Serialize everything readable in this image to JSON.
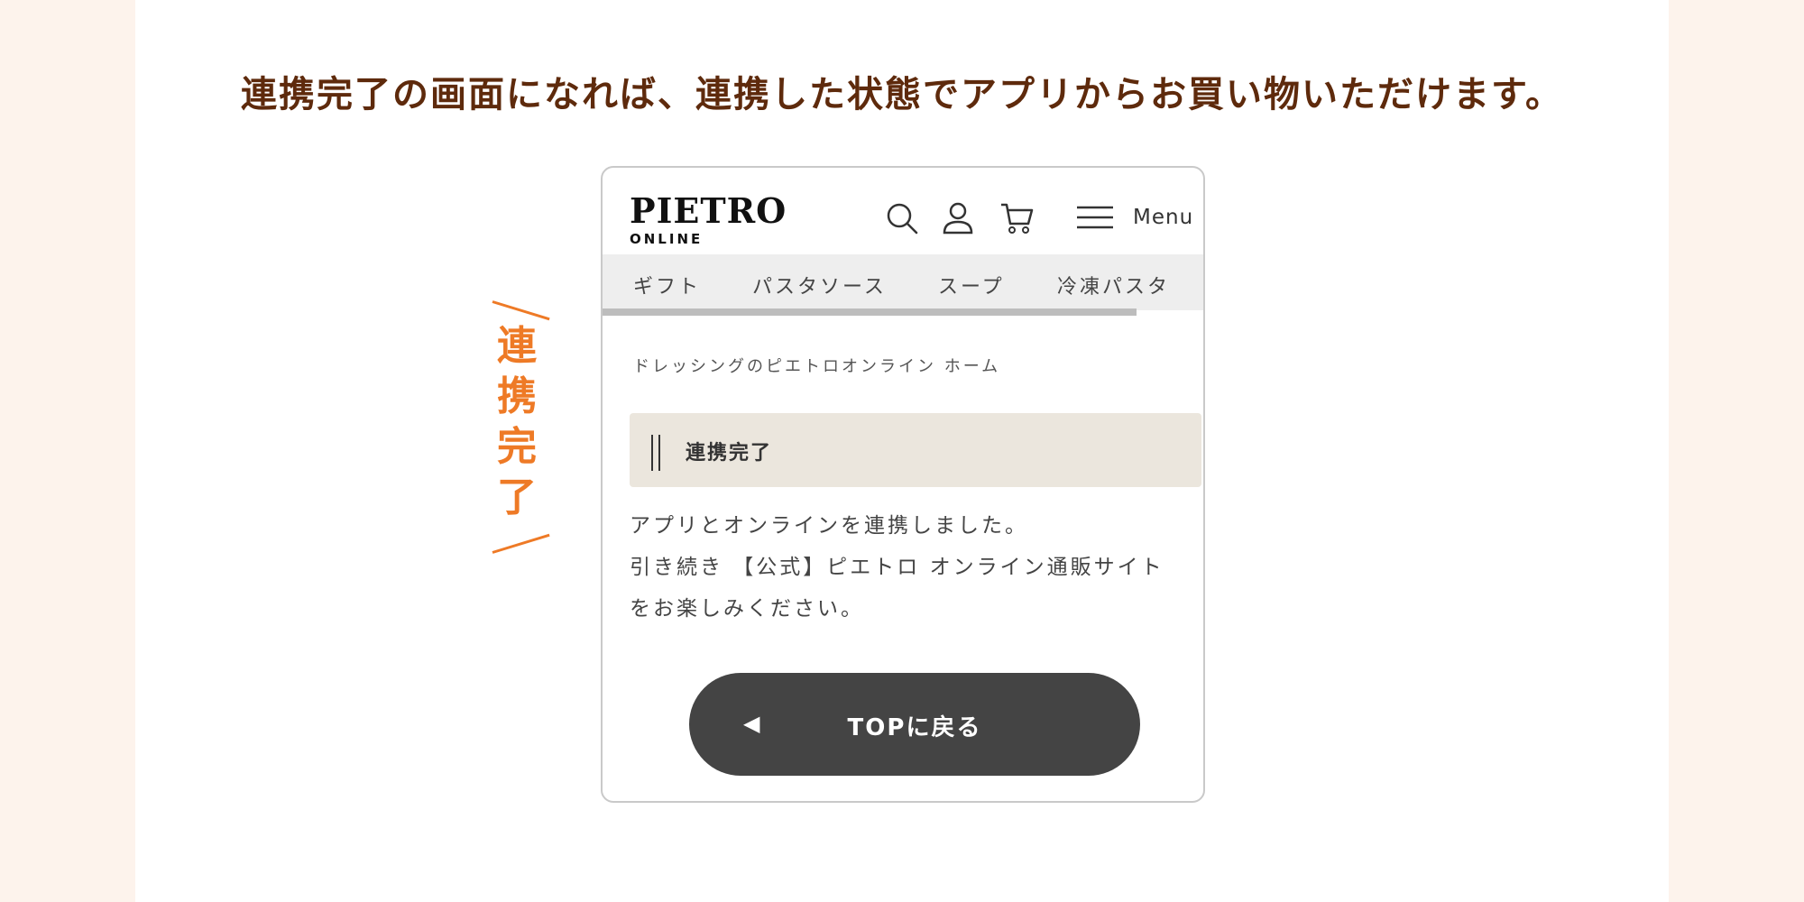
{
  "headline": "連携完了の画面になれば、連携した状態でアプリからお買い物いただけます。",
  "side_label": [
    "連",
    "携",
    "完",
    "了"
  ],
  "phone": {
    "logo_main": "PIETRO",
    "logo_sub": "ONLINE",
    "icons": [
      "search-icon",
      "user-icon",
      "cart-icon",
      "hamburger-menu-icon"
    ],
    "menu_label": "Menu",
    "categories": [
      "ギフト",
      "パスタソース",
      "スープ",
      "冷凍パスタ"
    ],
    "breadcrumb": "ドレッシングのピエトロオンライン ホーム",
    "notice_title": "連携完了",
    "message_lines": [
      "アプリとオンラインを連携しました。",
      "引き続き 【公式】ピエトロ オンライン通販サイト",
      "をお楽しみください。"
    ],
    "top_button_arrow": "◀",
    "top_button_label": "TOPに戻る"
  },
  "colors": {
    "headline": "#5e2a0c",
    "accent": "#ee7a26",
    "button_bg": "#444444",
    "notice_bg": "#ebe6dd",
    "page_bg": "#fdf3ec"
  }
}
